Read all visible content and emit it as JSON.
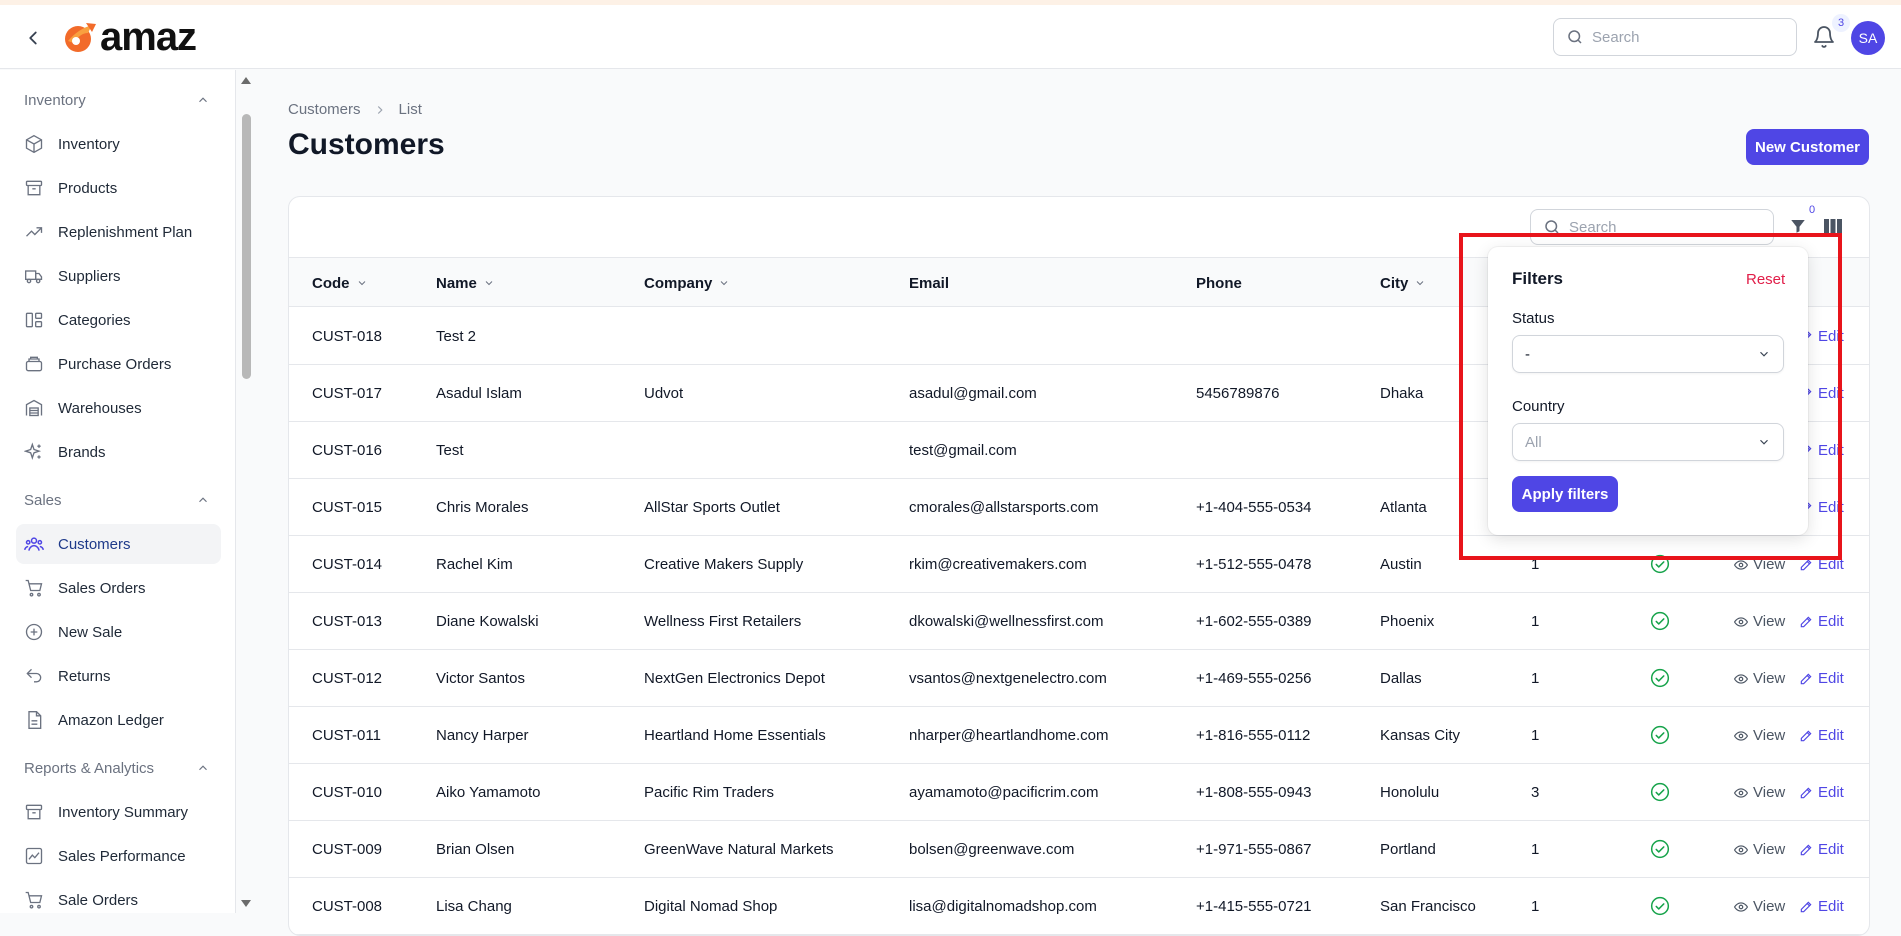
{
  "brand": {
    "name": "amaz"
  },
  "header": {
    "search_placeholder": "Search",
    "notification_count": "3",
    "avatar_initials": "SA"
  },
  "sidebar": {
    "sections": [
      {
        "title": "Inventory",
        "items": [
          {
            "label": "Inventory",
            "icon": "cube-icon"
          },
          {
            "label": "Products",
            "icon": "archive-icon"
          },
          {
            "label": "Replenishment Plan",
            "icon": "trending-up-icon"
          },
          {
            "label": "Suppliers",
            "icon": "truck-icon"
          },
          {
            "label": "Categories",
            "icon": "category-icon"
          },
          {
            "label": "Purchase Orders",
            "icon": "stack-icon"
          },
          {
            "label": "Warehouses",
            "icon": "building-icon"
          },
          {
            "label": "Brands",
            "icon": "sparkles-icon"
          }
        ]
      },
      {
        "title": "Sales",
        "items": [
          {
            "label": "Customers",
            "icon": "users-icon",
            "active": true
          },
          {
            "label": "Sales Orders",
            "icon": "cart-icon"
          },
          {
            "label": "New Sale",
            "icon": "plus-circle-icon"
          },
          {
            "label": "Returns",
            "icon": "return-icon"
          },
          {
            "label": "Amazon Ledger",
            "icon": "document-icon"
          }
        ]
      },
      {
        "title": "Reports & Analytics",
        "items": [
          {
            "label": "Inventory Summary",
            "icon": "archive-icon"
          },
          {
            "label": "Sales Performance",
            "icon": "chart-icon"
          },
          {
            "label": "Sale Orders",
            "icon": "cart-icon"
          }
        ]
      }
    ]
  },
  "breadcrumb": {
    "parent": "Customers",
    "current": "List"
  },
  "page": {
    "title": "Customers",
    "new_button": "New Customer"
  },
  "table": {
    "search_placeholder": "Search",
    "filter_count": "0",
    "columns": [
      "Code",
      "Name",
      "Company",
      "Email",
      "Phone",
      "City"
    ],
    "view_label": "View",
    "edit_label": "Edit",
    "rows": [
      {
        "code": "CUST-018",
        "name": "Test 2",
        "company": "",
        "email": "",
        "phone": "",
        "city": "",
        "orders": "",
        "active": false
      },
      {
        "code": "CUST-017",
        "name": "Asadul Islam",
        "company": "Udvot",
        "email": "asadul@gmail.com",
        "phone": "5456789876",
        "city": "Dhaka",
        "orders": "",
        "active": false
      },
      {
        "code": "CUST-016",
        "name": "Test",
        "company": "",
        "email": "test@gmail.com",
        "phone": "",
        "city": "",
        "orders": "",
        "active": false
      },
      {
        "code": "CUST-015",
        "name": "Chris Morales",
        "company": "AllStar Sports Outlet",
        "email": "cmorales@allstarsports.com",
        "phone": "+1-404-555-0534",
        "city": "Atlanta",
        "orders": "",
        "active": false
      },
      {
        "code": "CUST-014",
        "name": "Rachel Kim",
        "company": "Creative Makers Supply",
        "email": "rkim@creativemakers.com",
        "phone": "+1-512-555-0478",
        "city": "Austin",
        "orders": "1",
        "active": true
      },
      {
        "code": "CUST-013",
        "name": "Diane Kowalski",
        "company": "Wellness First Retailers",
        "email": "dkowalski@wellnessfirst.com",
        "phone": "+1-602-555-0389",
        "city": "Phoenix",
        "orders": "1",
        "active": true
      },
      {
        "code": "CUST-012",
        "name": "Victor Santos",
        "company": "NextGen Electronics Depot",
        "email": "vsantos@nextgenelectro.com",
        "phone": "+1-469-555-0256",
        "city": "Dallas",
        "orders": "1",
        "active": true
      },
      {
        "code": "CUST-011",
        "name": "Nancy Harper",
        "company": "Heartland Home Essentials",
        "email": "nharper@heartlandhome.com",
        "phone": "+1-816-555-0112",
        "city": "Kansas City",
        "orders": "1",
        "active": true
      },
      {
        "code": "CUST-010",
        "name": "Aiko Yamamoto",
        "company": "Pacific Rim Traders",
        "email": "ayamamoto@pacificrim.com",
        "phone": "+1-808-555-0943",
        "city": "Honolulu",
        "orders": "3",
        "active": true
      },
      {
        "code": "CUST-009",
        "name": "Brian Olsen",
        "company": "GreenWave Natural Markets",
        "email": "bolsen@greenwave.com",
        "phone": "+1-971-555-0867",
        "city": "Portland",
        "orders": "1",
        "active": true
      },
      {
        "code": "CUST-008",
        "name": "Lisa Chang",
        "company": "Digital Nomad Shop",
        "email": "lisa@digitalnomadshop.com",
        "phone": "+1-415-555-0721",
        "city": "San Francisco",
        "orders": "1",
        "active": true
      }
    ]
  },
  "filters": {
    "title": "Filters",
    "reset": "Reset",
    "status_label": "Status",
    "status_value": "-",
    "country_label": "Country",
    "country_value": "All",
    "apply": "Apply filters"
  },
  "colors": {
    "accent": "#4f46e5",
    "danger": "#e11d48",
    "success": "#16a34a",
    "highlight": "#e8141b"
  }
}
